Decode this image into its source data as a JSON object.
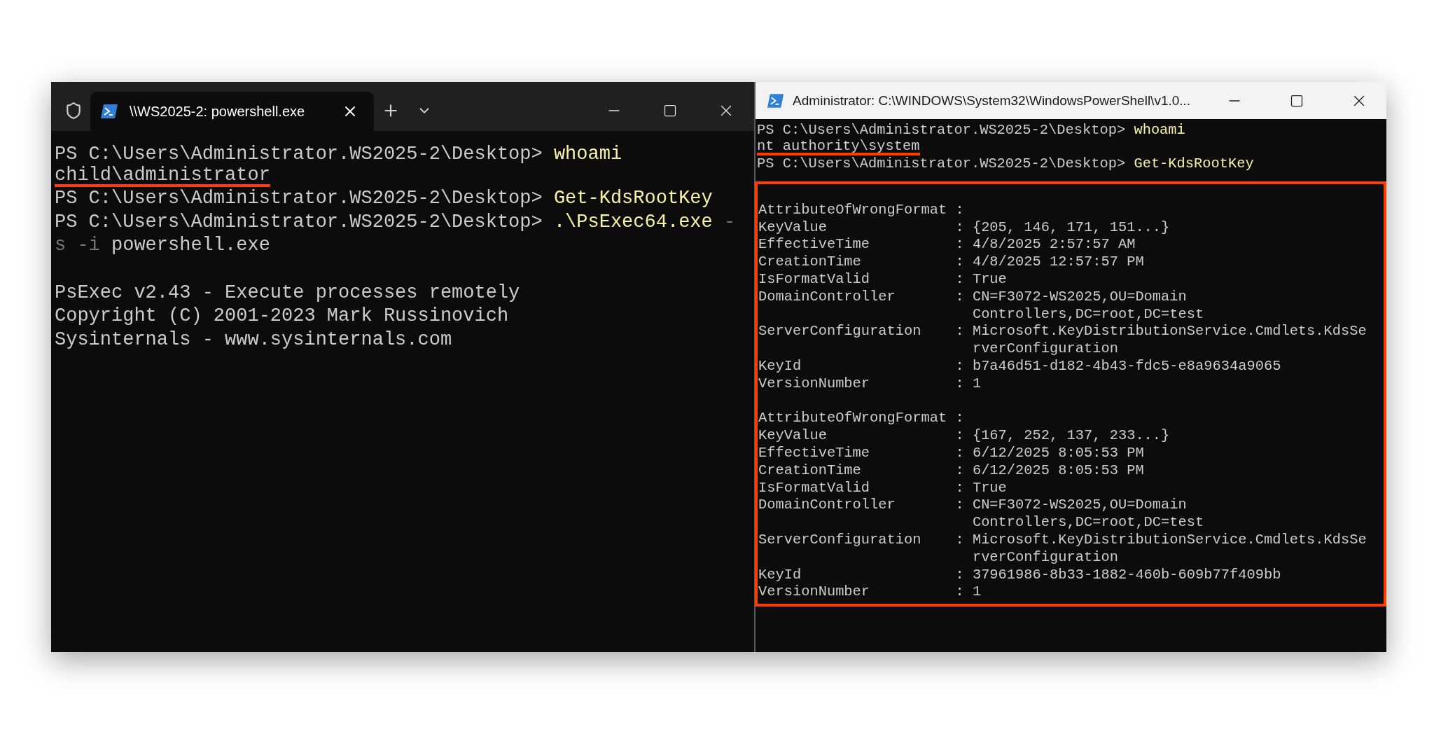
{
  "left_window": {
    "tab": {
      "title": "\\\\WS2025-2: powershell.exe",
      "selected": true
    },
    "lines": [
      {
        "kind": "text",
        "segments": [
          {
            "kind": "prompt",
            "text": "PS C:\\Users\\Administrator.WS2025-2\\Desktop>"
          },
          {
            "kind": "command",
            "text": "whoami"
          }
        ]
      },
      {
        "kind": "text",
        "segments": [
          {
            "kind": "output",
            "text": "child\\administrator",
            "underlined": true
          }
        ]
      },
      {
        "kind": "text",
        "segments": [
          {
            "kind": "prompt",
            "text": "PS C:\\Users\\Administrator.WS2025-2\\Desktop>"
          },
          {
            "kind": "command",
            "text": "Get-KdsRootKey"
          }
        ]
      },
      {
        "kind": "text",
        "segments": [
          {
            "kind": "prompt",
            "text": "PS C:\\Users\\Administrator.WS2025-2\\Desktop>"
          },
          {
            "kind": "command",
            "text": ".\\PsExec64.exe"
          },
          {
            "kind": "parameter",
            "text": "-"
          }
        ]
      },
      {
        "kind": "text",
        "segments": [
          {
            "kind": "parameter",
            "text": "s -i"
          },
          {
            "kind": "output",
            "text": "powershell.exe"
          }
        ]
      },
      {
        "kind": "blank"
      },
      {
        "kind": "text",
        "segments": [
          {
            "kind": "output",
            "text": "PsExec v2.43 - Execute processes remotely"
          }
        ]
      },
      {
        "kind": "text",
        "segments": [
          {
            "kind": "output",
            "text": "Copyright (C) 2001-2023 Mark Russinovich"
          }
        ]
      },
      {
        "kind": "text",
        "segments": [
          {
            "kind": "output",
            "text": "Sysinternals - www.sysinternals.com"
          }
        ]
      }
    ]
  },
  "right_window": {
    "title": "Administrator: C:\\WINDOWS\\System32\\WindowsPowerShell\\v1.0...",
    "lines": [
      {
        "kind": "text",
        "segments": [
          {
            "kind": "prompt",
            "text": "PS C:\\Users\\Administrator.WS2025-2\\Desktop>"
          },
          {
            "kind": "command",
            "text": "whoami"
          }
        ]
      },
      {
        "kind": "text",
        "segments": [
          {
            "kind": "output",
            "text": "nt authority\\system",
            "underlined": true
          }
        ]
      },
      {
        "kind": "text",
        "segments": [
          {
            "kind": "prompt",
            "text": "PS C:\\Users\\Administrator.WS2025-2\\Desktop>"
          },
          {
            "kind": "command",
            "text": "Get-KdsRootKey"
          }
        ]
      }
    ],
    "highlight_box": {
      "records": [
        {
          "fields": [
            {
              "name": "AttributeOfWrongFormat",
              "separator": ":"
            },
            {
              "name": "KeyValue",
              "separator": ":",
              "value": [
                "{205, 146, 171, 151...}"
              ]
            },
            {
              "name": "EffectiveTime",
              "separator": ":",
              "value": [
                "4/8/2025 2:57:57 AM"
              ]
            },
            {
              "name": "CreationTime",
              "separator": ":",
              "value": [
                "4/8/2025 12:57:57 PM"
              ]
            },
            {
              "name": "IsFormatValid",
              "separator": ":",
              "value": [
                "True"
              ]
            },
            {
              "name": "DomainController",
              "separator": ":",
              "value": [
                "CN=F3072-WS2025,OU=Domain",
                "Controllers,DC=root,DC=test"
              ]
            },
            {
              "name": "ServerConfiguration",
              "separator": ":",
              "value": [
                "Microsoft.KeyDistributionService.Cmdlets.KdsSe",
                "rverConfiguration"
              ]
            },
            {
              "name": "KeyId",
              "separator": ":",
              "value": [
                "b7a46d51-d182-4b43-fdc5-e8a9634a9065"
              ]
            },
            {
              "name": "VersionNumber",
              "separator": ":",
              "value": [
                "1"
              ]
            }
          ]
        },
        {
          "fields": [
            {
              "name": "AttributeOfWrongFormat",
              "separator": ":"
            },
            {
              "name": "KeyValue",
              "separator": ":",
              "value": [
                "{167, 252, 137, 233...}"
              ]
            },
            {
              "name": "EffectiveTime",
              "separator": ":",
              "value": [
                "6/12/2025 8:05:53 PM"
              ]
            },
            {
              "name": "CreationTime",
              "separator": ":",
              "value": [
                "6/12/2025 8:05:53 PM"
              ]
            },
            {
              "name": "IsFormatValid",
              "separator": ":",
              "value": [
                "True"
              ]
            },
            {
              "name": "DomainController",
              "separator": ":",
              "value": [
                "CN=F3072-WS2025,OU=Domain",
                "Controllers,DC=root,DC=test"
              ]
            },
            {
              "name": "ServerConfiguration",
              "separator": ":",
              "value": [
                "Microsoft.KeyDistributionService.Cmdlets.KdsSe",
                "rverConfiguration"
              ]
            },
            {
              "name": "KeyId",
              "separator": ":",
              "value": [
                "37961986-8b33-1882-460b-609b77f409bb"
              ]
            },
            {
              "name": "VersionNumber",
              "separator": ":",
              "value": [
                "1"
              ]
            }
          ]
        }
      ]
    }
  }
}
